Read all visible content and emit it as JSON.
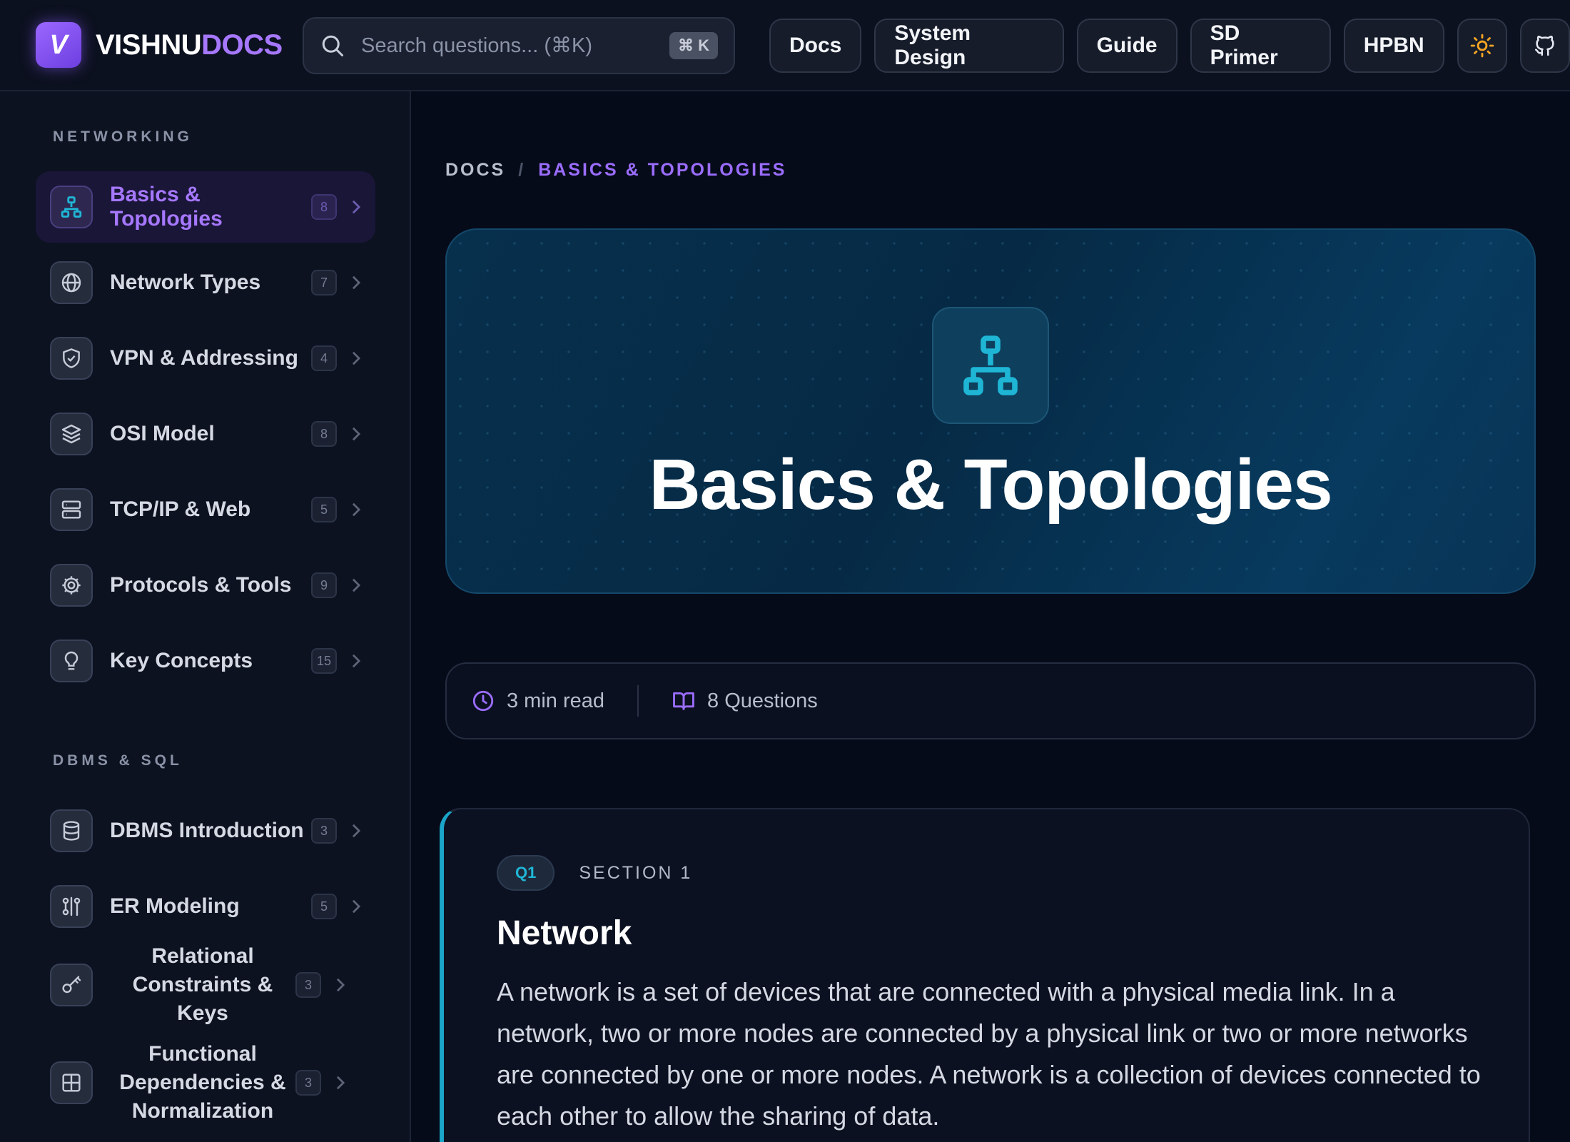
{
  "brand": {
    "logo_letter": "V",
    "name_part1": "VISHNU",
    "name_part2": "DOCS"
  },
  "search": {
    "placeholder": "Search questions... (⌘K)",
    "shortcut": "⌘ K"
  },
  "nav": {
    "items": [
      "Docs",
      "System Design",
      "Guide",
      "SD Primer",
      "HPBN"
    ],
    "theme_icon": "sun-icon",
    "github_icon": "github-icon"
  },
  "sidebar": {
    "groups": [
      {
        "title": "NETWORKING",
        "items": [
          {
            "label": "Basics & Topologies",
            "count": "8",
            "icon": "topology-icon",
            "active": true
          },
          {
            "label": "Network Types",
            "count": "7",
            "icon": "globe-icon"
          },
          {
            "label": "VPN & Addressing",
            "count": "4",
            "icon": "shield-icon"
          },
          {
            "label": "OSI Model",
            "count": "8",
            "icon": "layers-icon"
          },
          {
            "label": "TCP/IP & Web",
            "count": "5",
            "icon": "server-icon"
          },
          {
            "label": "Protocols & Tools",
            "count": "9",
            "icon": "gear-icon"
          },
          {
            "label": "Key Concepts",
            "count": "15",
            "icon": "lightbulb-icon"
          }
        ]
      },
      {
        "title": "DBMS & SQL",
        "items": [
          {
            "label": "DBMS Introduction",
            "count": "3",
            "icon": "database-icon"
          },
          {
            "label": "ER Modeling",
            "count": "5",
            "icon": "relationship-icon"
          },
          {
            "label": "Relational Constraints & Keys",
            "count": "3",
            "icon": "key-icon"
          },
          {
            "label": "Functional Dependencies & Normalization",
            "count": "3",
            "icon": "table-icon"
          }
        ]
      }
    ]
  },
  "breadcrumb": {
    "root": "DOCS",
    "separator": "/",
    "current": "BASICS & TOPOLOGIES"
  },
  "hero": {
    "title": "Basics & Topologies",
    "icon": "topology-icon"
  },
  "meta": {
    "read_time": "3 min read",
    "questions": "8 Questions"
  },
  "section": {
    "badge": "Q1",
    "label": "SECTION 1",
    "title": "Network",
    "body": "A network is a set of devices that are connected with a physical media link. In a network, two or more nodes are connected by a physical link or two or more networks are connected by one or more nodes. A network is a collection of devices connected to each other to allow the sharing of data."
  },
  "colors": {
    "accent": "#a678ff",
    "teal": "#1fb6d6",
    "background": "#060b1a"
  }
}
